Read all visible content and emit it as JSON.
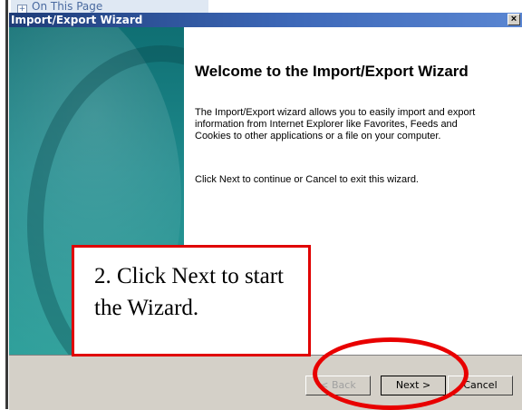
{
  "page": {
    "on_this_page_label": "On This Page",
    "expand_glyph": "+"
  },
  "dialog": {
    "title": "Import/Export Wizard",
    "close_glyph": "×",
    "heading": "Welcome to the Import/Export Wizard",
    "paragraph1": "The Import/Export wizard allows you to easily import and export information from Internet Explorer like Favorites, Feeds and Cookies to other applications or a file on your computer.",
    "paragraph2": "Click Next to continue or Cancel to exit this wizard.",
    "buttons": {
      "back": "< Back",
      "next": "Next >",
      "cancel": "Cancel"
    }
  },
  "annotation": {
    "callout_text": "2.  Click Next to start the Wizard.",
    "highlight_color": "#e00000"
  },
  "colors": {
    "title_bar": "#1e3c78",
    "side_panel": "#1e8a8c",
    "dialog_face": "#d4d0c8"
  },
  "icons": {
    "expand": "plus-box-icon",
    "close": "close-icon"
  }
}
